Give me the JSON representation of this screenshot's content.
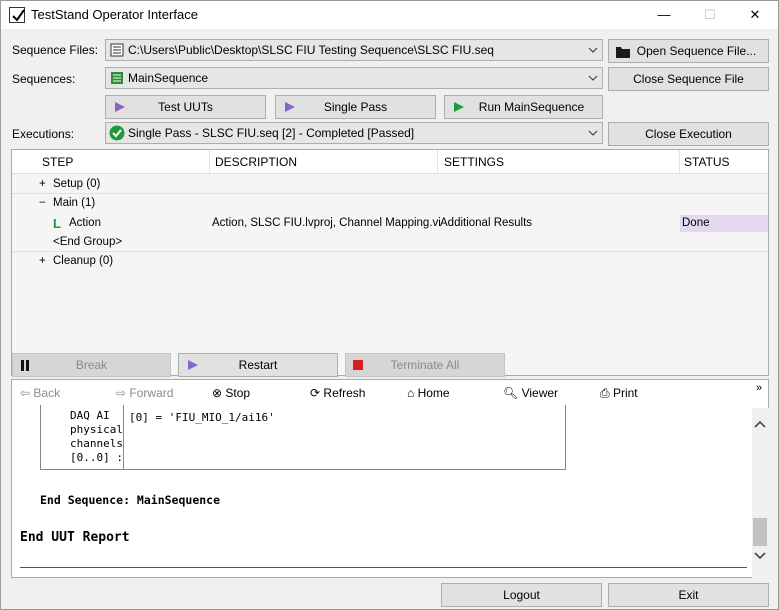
{
  "window": {
    "title": "TestStand Operator Interface",
    "minimize": "—",
    "maximize": "☐",
    "close": "✕"
  },
  "form": {
    "sequence_files_label": "Sequence Files:",
    "sequence_files_value": "C:\\Users\\Public\\Desktop\\SLSC FIU Testing Sequence\\SLSC FIU.seq",
    "sequences_label": "Sequences:",
    "sequences_value": "MainSequence",
    "executions_label": "Executions:",
    "executions_value": "Single Pass - SLSC FIU.seq [2] - Completed [Passed]",
    "open_sequence_file": "Open Sequence File...",
    "close_sequence_file": "Close Sequence File",
    "close_execution": "Close Execution"
  },
  "entry_points": {
    "test_uuts": "Test UUTs",
    "single_pass": "Single Pass",
    "run_main": "Run MainSequence"
  },
  "steps_grid": {
    "columns": [
      "STEP",
      "DESCRIPTION",
      "SETTINGS",
      "STATUS"
    ],
    "rows": [
      {
        "expander": "+",
        "step": "Setup (0)",
        "description": "",
        "settings": "",
        "status": ""
      },
      {
        "expander": "−",
        "step": "Main (1)",
        "description": "",
        "settings": "",
        "status": ""
      },
      {
        "expander": "",
        "step": "Action",
        "description": "Action,  SLSC FIU.lvproj, Channel Mapping.vi",
        "settings": "Additional Results",
        "status": "Done"
      },
      {
        "expander": "",
        "step": "<End Group>",
        "description": "",
        "settings": "",
        "status": ""
      },
      {
        "expander": "+",
        "step": "Cleanup (0)",
        "description": "",
        "settings": "",
        "status": ""
      }
    ],
    "action_icon": "L"
  },
  "execution_controls": {
    "break": "Break",
    "restart": "Restart",
    "terminate_all": "Terminate All"
  },
  "browser_toolbar": {
    "back": "Back",
    "forward": "Forward",
    "stop": "Stop",
    "refresh": "Refresh",
    "home": "Home",
    "viewer": "Viewer",
    "print": "Print",
    "overflow": "»"
  },
  "report": {
    "table_label": "DAQ AI\nphysical\nchannels\n[0..0] :",
    "table_value": "[0] = 'FIU_MIO_1/ai16'",
    "end_sequence": "End Sequence: MainSequence",
    "end_uut": "End UUT Report"
  },
  "bottom_buttons": {
    "logout": "Logout",
    "exit": "Exit"
  }
}
